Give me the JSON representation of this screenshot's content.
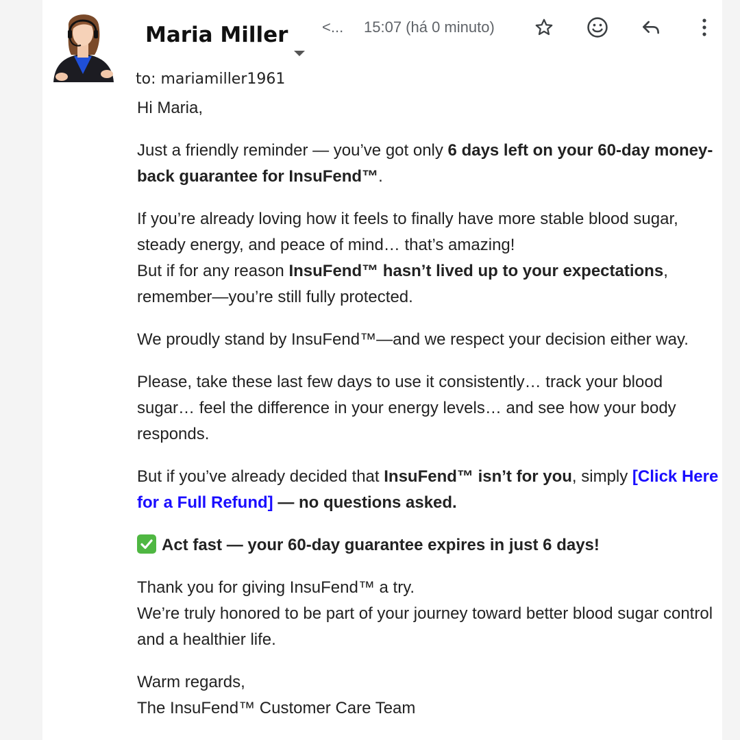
{
  "header": {
    "sender_name": "Maria Miller",
    "to_line": "to: mariamiller1961",
    "nav_back": "<...",
    "timestamp": "15:07 (há 0 minuto)",
    "icons": [
      "star-icon",
      "emoji-icon",
      "reply-icon",
      "more-vert-icon"
    ]
  },
  "email": {
    "greeting": "Hi Maria,",
    "p1_pre": "Just a friendly reminder — you’ve got only ",
    "p1_bold": "6 days left on your 60-day money-back guarantee for InsuFend™",
    "p1_post": ".",
    "p2_line1": "If you’re already loving how it feels to finally have more stable blood sugar, steady energy, and peace of mind… that’s amazing!",
    "p2_line2_pre": "But if for any reason ",
    "p2_line2_bold": "InsuFend™ hasn’t lived up to your expectations",
    "p2_line2_post": ", remember—you’re still fully protected.",
    "p3": "We proudly stand by InsuFend™—and we respect your decision either way.",
    "p4": "Please, take these last few days to use it consistently… track your blood sugar… feel the difference in your energy levels… and see how your body responds.",
    "p5_pre": "But if you’ve already decided that ",
    "p5_bold": "InsuFend™ isn’t for you",
    "p5_mid": ", simply ",
    "p5_link": "[Click Here for a Full Refund]",
    "p5_post": " — no questions asked.",
    "p6_bold": "Act fast — your 60-day guarantee expires in just 6 days!",
    "p7_line1": "Thank you for giving InsuFend™ a try.",
    "p7_line2": "We’re truly honored to be part of your journey toward better blood sugar control and a healthier life.",
    "sign_line1": "Warm regards,",
    "sign_line2": "The InsuFend™ Customer Care Team"
  },
  "colors": {
    "link": "#1a0dff",
    "check": "#4fb742",
    "text": "#222222",
    "icon": "#5f6368"
  }
}
